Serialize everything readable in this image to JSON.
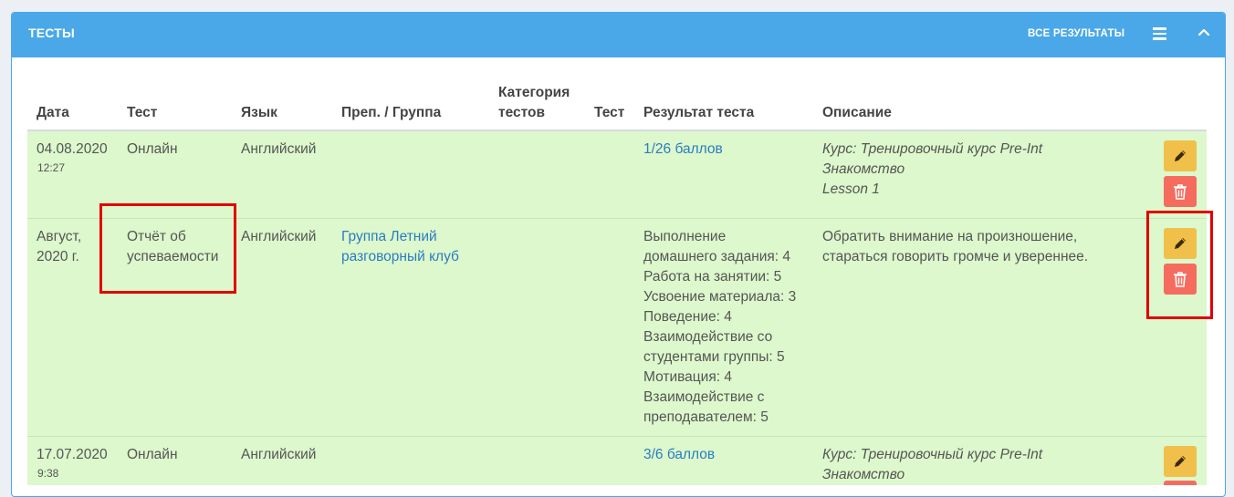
{
  "panel": {
    "title": "ТЕСТЫ",
    "all_results_label": "ВСЕ РЕЗУЛЬТАТЫ",
    "menu_icon": "hamburger-menu-icon",
    "collapse_icon": "chevron-up-icon",
    "header_color": "#4aa8e8"
  },
  "table": {
    "columns": {
      "date": "Дата",
      "test": "Тест",
      "language": "Язык",
      "teacher_group": "Преп. / Группа",
      "category_line1": "Категория",
      "category_line2": "тестов",
      "test2": "Тест",
      "result": "Результат теста",
      "description": "Описание"
    },
    "rows": [
      {
        "date": "04.08.2020",
        "time": "12:27",
        "test": "Онлайн",
        "language": "Английский",
        "group_lines": [],
        "result_lines": [
          "1/26 баллов"
        ],
        "description_lines": [
          "Курс: Тренировочный курс Pre-Int",
          "Знакомство",
          "Lesson 1"
        ]
      },
      {
        "date_lines": [
          "Август,",
          "2020 г."
        ],
        "test_lines": [
          "Отчёт об",
          "успеваемости"
        ],
        "language": "Английский",
        "group_lines": [
          "Группа Летний",
          "разговорный клуб"
        ],
        "result_lines": [
          "Выполнение",
          "домашнего задания: 4",
          "Работа на занятии: 5",
          "Усвоение материала: 3",
          "Поведение: 4",
          "Взаимодействие со",
          "студентами группы: 5",
          "Мотивация: 4",
          "Взаимодействие с",
          "преподавателем: 5"
        ],
        "description_lines": [
          "Обратить внимание на произношение,",
          "стараться говорить громче и увереннее."
        ]
      },
      {
        "date": "17.07.2020",
        "time": "9:38",
        "test": "Онлайн",
        "language": "Английский",
        "group_lines": [],
        "result_lines": [
          "3/6 баллов"
        ],
        "description_lines": [
          "Курс: Тренировочный курс Pre-Int",
          "Знакомство"
        ]
      }
    ],
    "row_color": "#dcf8cc",
    "link_color": "#2b7cc1"
  },
  "actions": {
    "edit_icon": "pencil-icon",
    "delete_icon": "trash-icon",
    "edit_color": "#f0c04a",
    "delete_color": "#f56c5f"
  },
  "annotations": {
    "highlight_color": "#e00000"
  }
}
